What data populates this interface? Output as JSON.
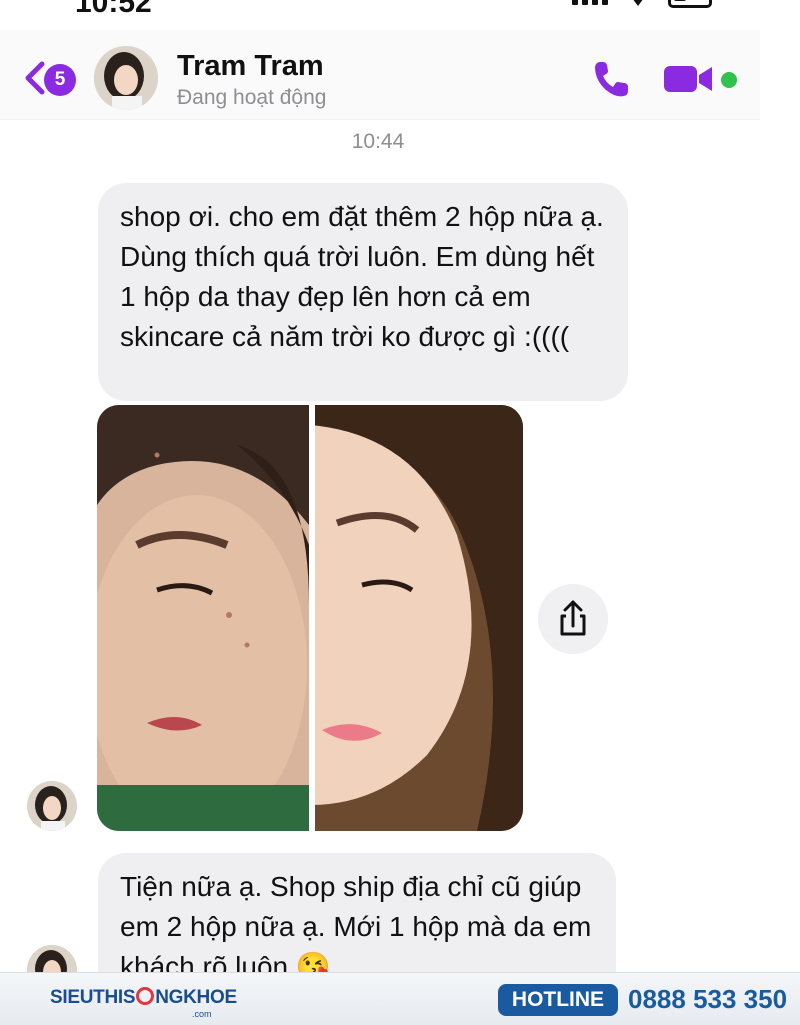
{
  "status_bar": {
    "time": "10:52"
  },
  "header": {
    "back_badge": "5",
    "contact_name": "Tram Tram",
    "contact_status": "Đang hoạt động"
  },
  "conversation": {
    "timestamp": "10:44",
    "messages": [
      {
        "text": "shop ơi. cho em đặt thêm 2 hộp nữa ạ. Dùng thích quá trời luôn. Em dùng hết 1 hộp da thay đẹp lên hơn cả em skincare cả năm trời ko được gì :(((("
      },
      {
        "text": "Tiện nữa ạ. Shop ship địa chỉ cũ giúp em 2 hộp nữa ạ. Mới 1 hộp mà da em khách rõ luôn 😘"
      }
    ]
  },
  "footer": {
    "brand_prefix": "SIEUTHIS",
    "brand_suffix": "NGKHOE",
    "brand_domain": ".com",
    "hotline_label": "HOTLINE",
    "hotline_number": "0888 533 350"
  },
  "colors": {
    "accent": "#8a2be2",
    "online": "#31c24d",
    "bubble": "#efeff1",
    "footer_blue": "#1a5aa0"
  },
  "icons": [
    "back-chevron-icon",
    "phone-icon",
    "video-camera-icon",
    "share-icon",
    "signal-icon",
    "wifi-icon",
    "battery-icon"
  ]
}
